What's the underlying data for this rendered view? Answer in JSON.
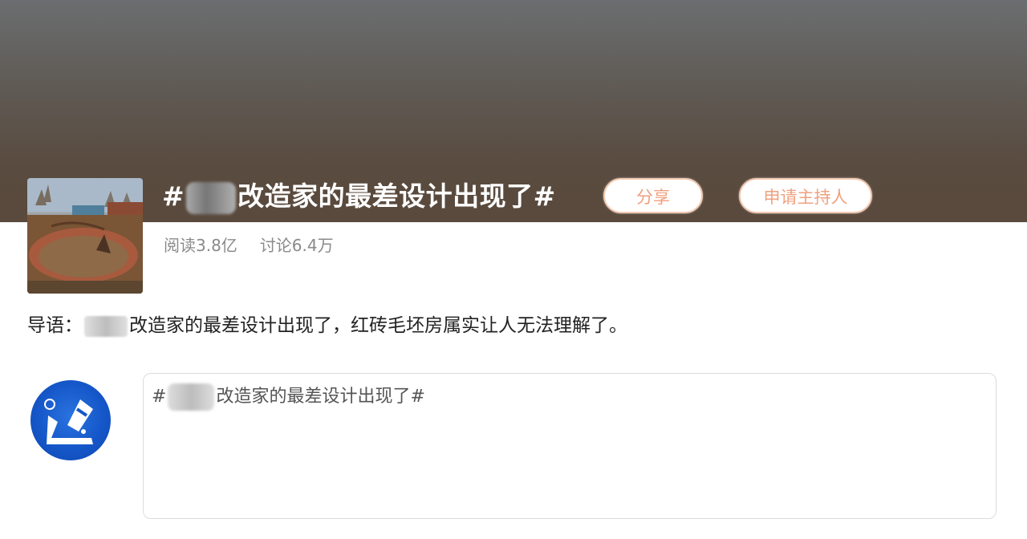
{
  "topic": {
    "title_prefix": "#",
    "title_suffix": "改造家的最差设计出现了#",
    "stats": {
      "reads": "阅读3.8亿",
      "discussions": "讨论6.4万"
    }
  },
  "actions": {
    "share_label": "分享",
    "host_label": "申请主持人"
  },
  "intro": {
    "label": "导语：",
    "text": "改造家的最差设计出现了，红砖毛坯房属实让人无法理解了。"
  },
  "editor": {
    "prefix": "#",
    "text": "改造家的最差设计出现了#"
  },
  "colors": {
    "accent": "#f0a07e",
    "pill_border": "#f3c9b0",
    "avatar_blue": "#1557c9"
  }
}
